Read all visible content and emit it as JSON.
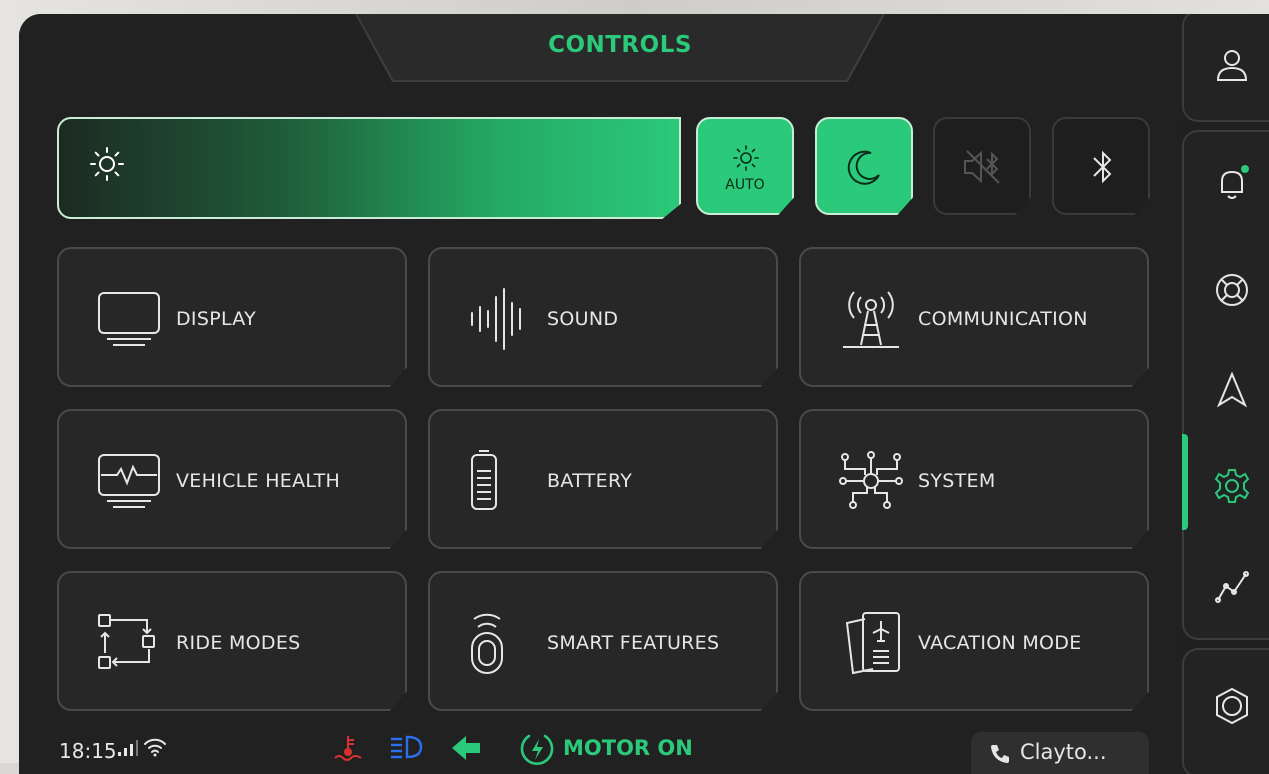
{
  "header": {
    "title": "CONTROLS"
  },
  "quick_controls": {
    "brightness_level": 1.0,
    "auto_label": "AUTO",
    "buttons": [
      {
        "name": "auto-brightness",
        "active": true,
        "icon": "sun-auto-icon"
      },
      {
        "name": "night-mode",
        "active": true,
        "icon": "moon-icon"
      },
      {
        "name": "mute-bluetooth-audio",
        "active": false,
        "icon": "speaker-bluetooth-mute-icon"
      },
      {
        "name": "bluetooth",
        "active": false,
        "icon": "bluetooth-icon"
      }
    ]
  },
  "tiles": [
    {
      "label": "DISPLAY",
      "icon": "monitor-icon"
    },
    {
      "label": "SOUND",
      "icon": "sound-wave-icon"
    },
    {
      "label": "COMMUNICATION",
      "icon": "antenna-tower-icon"
    },
    {
      "label": "VEHICLE HEALTH",
      "icon": "health-monitor-icon"
    },
    {
      "label": "BATTERY",
      "icon": "battery-icon"
    },
    {
      "label": "SYSTEM",
      "icon": "circuit-icon"
    },
    {
      "label": "RIDE MODES",
      "icon": "flow-modes-icon"
    },
    {
      "label": "SMART FEATURES",
      "icon": "smart-key-icon"
    },
    {
      "label": "VACATION MODE",
      "icon": "travel-docs-icon"
    }
  ],
  "status_bar": {
    "time": "18:15",
    "motor_status": "MOTOR ON",
    "call_name": "Clayto..."
  },
  "sidebar": {
    "items": [
      "user-icon",
      "bell-icon",
      "lifebuoy-icon",
      "navigation-icon",
      "gear-icon",
      "analytics-icon",
      "ring-icon"
    ],
    "active": "gear-icon"
  },
  "colors": {
    "accent": "#2bc97a",
    "background": "#212121",
    "warning": "#d93030",
    "info": "#2d6ef0"
  }
}
